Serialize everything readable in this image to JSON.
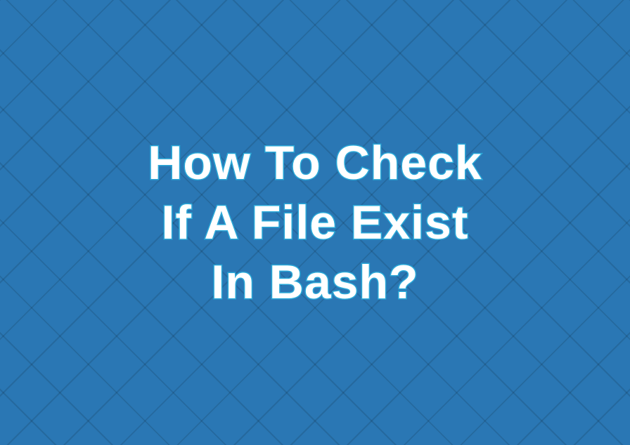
{
  "title": {
    "line1": "How To Check",
    "line2": "If A File Exist",
    "line3": "In Bash?"
  },
  "colors": {
    "background": "#2a77b4",
    "textFill": "#ffffff",
    "textStroke": "#2aa9d8",
    "gridLine": "rgba(0,0,0,0.12)"
  }
}
